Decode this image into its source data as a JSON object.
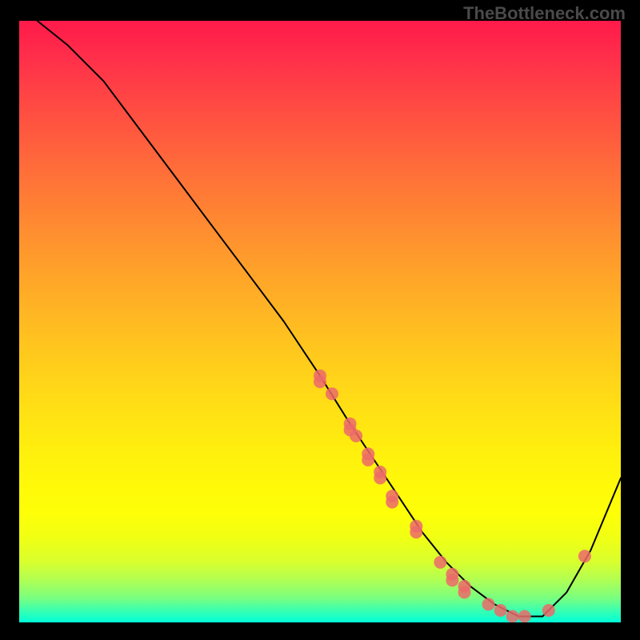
{
  "watermark": "TheBottleneck.com",
  "chart_data": {
    "type": "line",
    "title": "",
    "xlabel": "",
    "ylabel": "",
    "xlim": [
      0,
      100
    ],
    "ylim": [
      0,
      100
    ],
    "curve": {
      "x": [
        3,
        8,
        14,
        20,
        26,
        32,
        38,
        44,
        50,
        55,
        59,
        63,
        67,
        71,
        75,
        79,
        83,
        87,
        91,
        95,
        100
      ],
      "y": [
        100,
        96,
        90,
        82,
        74,
        66,
        58,
        50,
        41,
        33,
        27,
        21,
        15,
        10,
        6,
        3,
        1,
        1,
        5,
        12,
        24
      ]
    },
    "series": [
      {
        "name": "data-points",
        "type": "scatter",
        "color": "#ec6a6a",
        "x": [
          50,
          50,
          52,
          55,
          55,
          56,
          58,
          58,
          60,
          60,
          62,
          62,
          66,
          66,
          70,
          72,
          72,
          74,
          74,
          78,
          80,
          82,
          84,
          88,
          94
        ],
        "y": [
          41,
          40,
          38,
          33,
          32,
          31,
          28,
          27,
          25,
          24,
          21,
          20,
          16,
          15,
          10,
          8,
          7,
          6,
          5,
          3,
          2,
          1,
          1,
          2,
          11
        ]
      }
    ]
  }
}
